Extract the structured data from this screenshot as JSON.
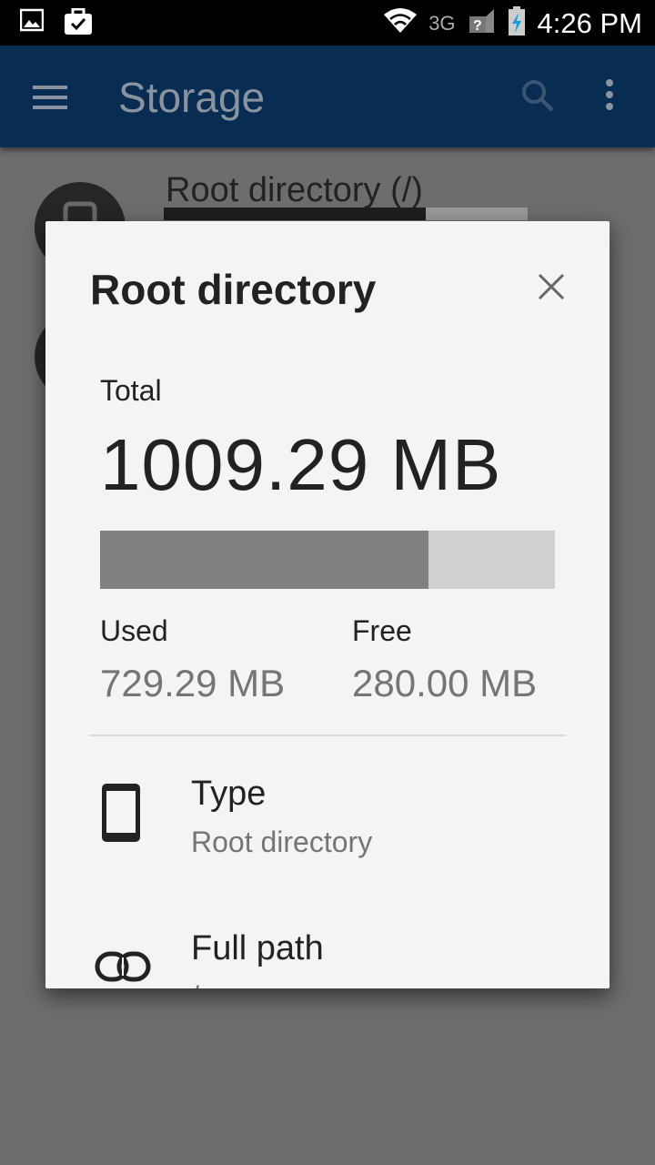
{
  "status_bar": {
    "network": "3G",
    "time": "4:26 PM"
  },
  "app_bar": {
    "title": "Storage"
  },
  "background_list": {
    "item_title": "Root directory (/)",
    "usage_fraction": 0.72
  },
  "dialog": {
    "title": "Root directory",
    "total_label": "Total",
    "total_value": "1009.29 MB",
    "used_fraction": 0.7226,
    "used_label": "Used",
    "used_value": "729.29 MB",
    "free_label": "Free",
    "free_value": "280.00 MB",
    "type_label": "Type",
    "type_value": "Root directory",
    "path_label": "Full path",
    "path_value": "/"
  },
  "colors": {
    "app_bar": "#082c52",
    "scrim": "#6d6d6d",
    "dialog_bg": "#f4f4f4",
    "bar_used": "#808080",
    "bar_free": "#d0d0d0"
  }
}
